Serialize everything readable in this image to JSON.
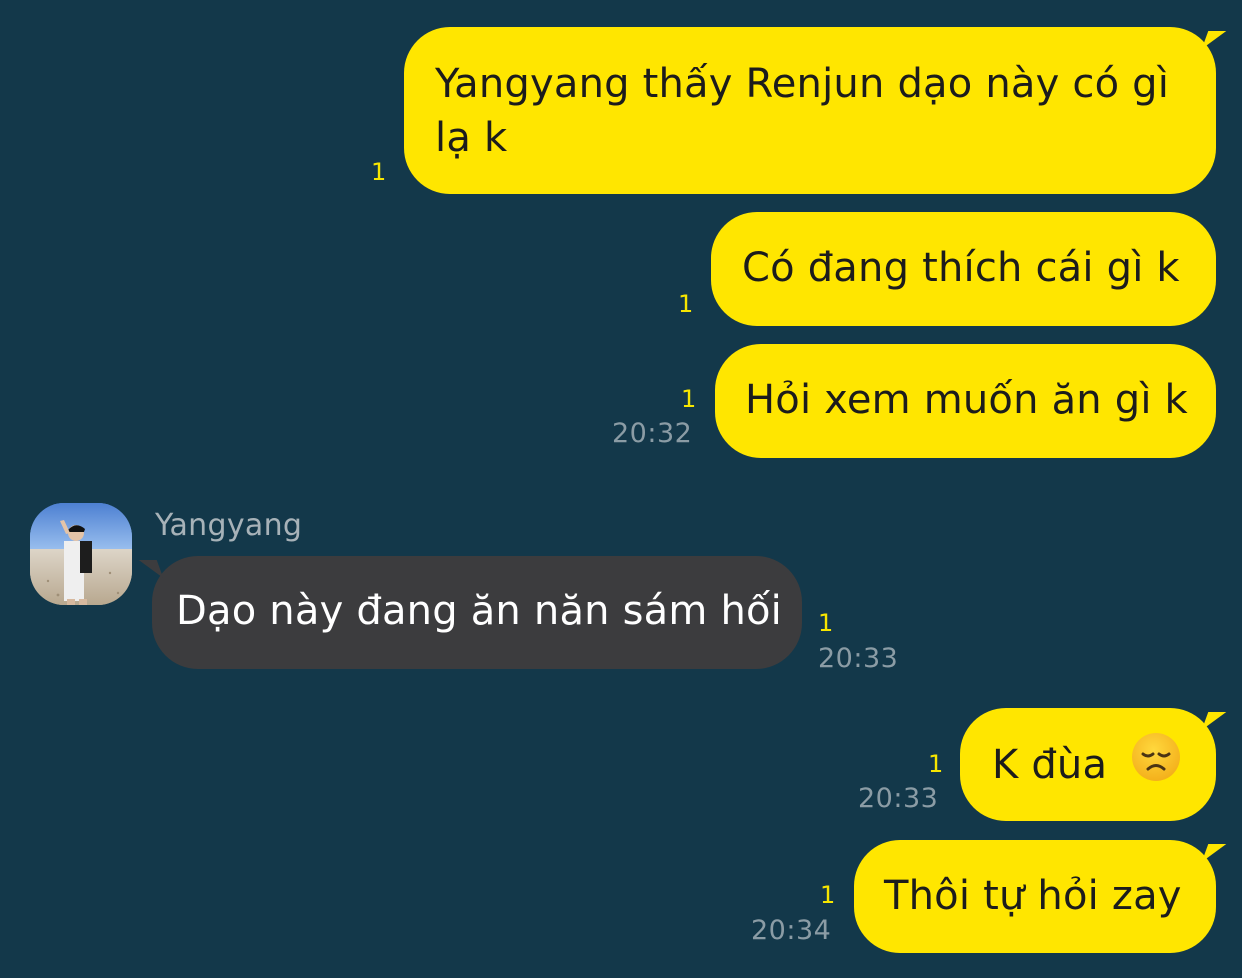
{
  "contact": {
    "name": "Yangyang"
  },
  "colors": {
    "background": "#13384a",
    "outgoing_bubble": "#ffe600",
    "incoming_bubble": "#3c3c3e",
    "unread_count": "#f7e600",
    "timestamp": "#8b9ca5"
  },
  "messages": [
    {
      "direction": "outgoing",
      "lines": [
        "Yangyang thấy Renjun dạo này có gì",
        "lạ k"
      ],
      "unread": "1",
      "time": ""
    },
    {
      "direction": "outgoing",
      "text": "Có đang thích cái gì k",
      "unread": "1",
      "time": ""
    },
    {
      "direction": "outgoing",
      "text": "Hỏi xem muốn ăn gì k",
      "unread": "1",
      "time": "20:32"
    },
    {
      "direction": "incoming",
      "sender": "Yangyang",
      "text": "Dạo này đang ăn năn sám hối",
      "unread": "1",
      "time": "20:33"
    },
    {
      "direction": "outgoing",
      "text": "K đùa",
      "emoji_icon": "disappointed-face-icon",
      "unread": "1",
      "time": "20:33"
    },
    {
      "direction": "outgoing",
      "text": "Thôi tự hỏi zay",
      "unread": "1",
      "time": "20:34"
    }
  ]
}
